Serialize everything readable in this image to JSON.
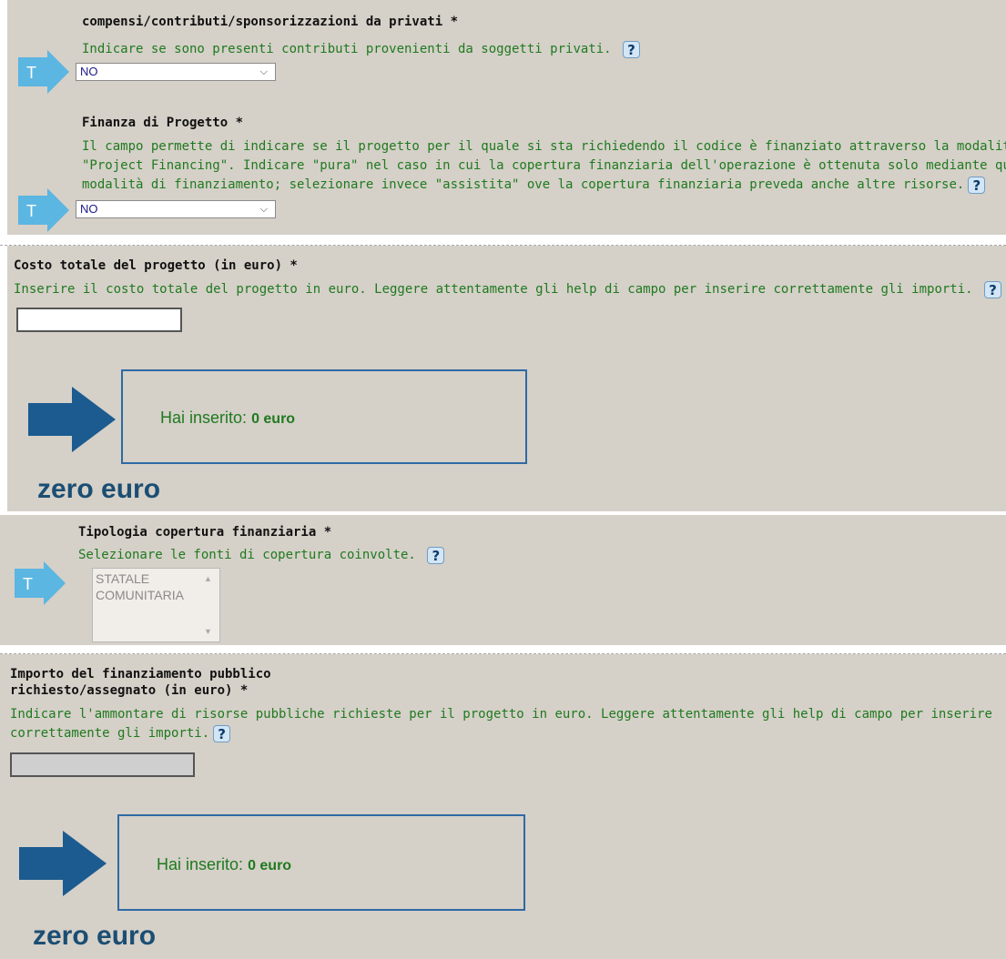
{
  "privati": {
    "label": "compensi/contributi/sponsorizzazioni da privati *",
    "help": "Indicare se sono presenti contributi provenienti da soggetti privati.",
    "help_button": "?",
    "type_marker": "T",
    "selected": "NO"
  },
  "finanza": {
    "label": "Finanza di Progetto *",
    "help_lines": [
      "Il campo permette di indicare se il progetto per il quale si sta richiedendo il codice è finanziato attraverso la modalità di",
      "\"Project Financing\". Indicare \"pura\" nel caso in cui la copertura finanziaria dell'operazione è ottenuta solo mediante questa",
      "modalità di finanziamento; selezionare invece \"assistita\" ove la copertura finanziaria preveda anche altre risorse."
    ],
    "help_button": "?",
    "type_marker": "T",
    "selected": "NO"
  },
  "costo": {
    "label": "Costo totale del progetto (in euro) *",
    "help": "Inserire il costo totale del progetto in euro. Leggere attentamente gli help di campo per inserire correttamente gli importi.",
    "help_button": "?",
    "value": "",
    "hai_inserito_label": "Hai inserito:",
    "hai_inserito_value": "0 euro",
    "amount_words": "zero euro"
  },
  "tipologia": {
    "label": "Tipologia copertura finanziaria *",
    "help": "Selezionare le fonti di copertura coinvolte.",
    "help_button": "?",
    "type_marker": "T",
    "options": [
      "STATALE",
      "COMUNITARIA"
    ]
  },
  "importo": {
    "label_line1": "Importo del finanziamento pubblico",
    "label_line2": "richiesto/assegnato (in euro) *",
    "help_line1": "Indicare l'ammontare di risorse pubbliche richieste per il progetto in euro. Leggere attentamente gli help di campo per inserire",
    "help_line2": "correttamente gli importi.",
    "help_button": "?",
    "value": "",
    "hai_inserito_label": "Hai inserito:",
    "hai_inserito_value": "0 euro",
    "amount_words": "zero euro"
  },
  "colors": {
    "panel_bg": "#d5d0c8",
    "help_text": "#1f7a1f",
    "arrow_light": "#5bb6e2",
    "arrow_dark": "#1b5b8f",
    "box_border": "#2e6aa4"
  }
}
